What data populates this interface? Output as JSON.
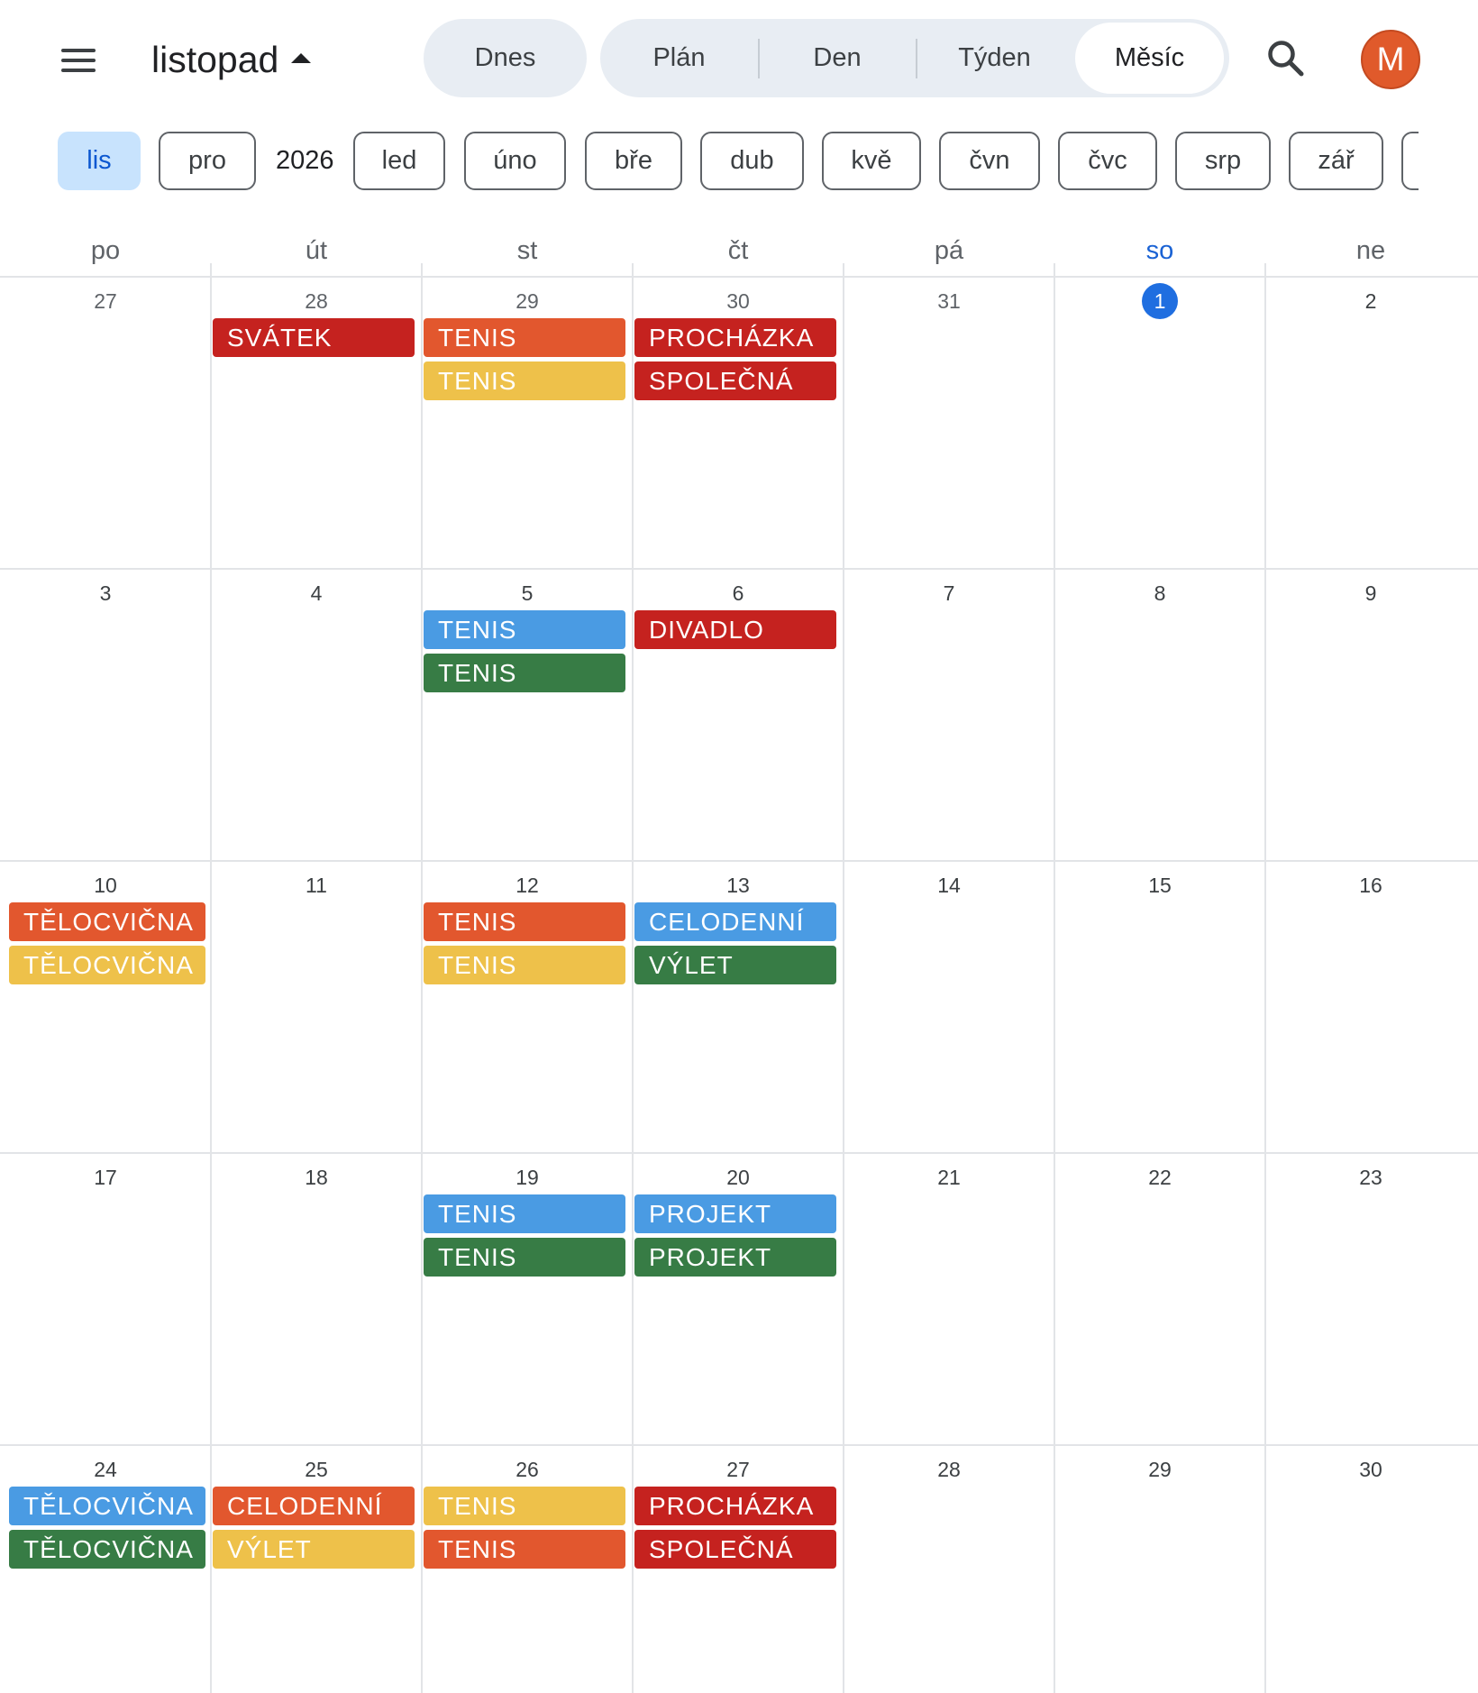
{
  "header": {
    "month": "listopad",
    "today_label": "Dnes",
    "views": [
      "Plán",
      "Den",
      "Týden",
      "Měsíc"
    ],
    "active_view": "Měsíc",
    "avatar_letter": "M",
    "icons": [
      "menu-icon",
      "caret-up-icon",
      "search-icon"
    ]
  },
  "month_chips": {
    "active": "lis",
    "prev_year": [
      "lis",
      "pro"
    ],
    "year": "2026",
    "next_year": [
      "led",
      "úno",
      "bře",
      "dub",
      "kvě",
      "čvn",
      "čvc",
      "srp",
      "zář"
    ]
  },
  "weekdays": [
    "po",
    "út",
    "st",
    "čt",
    "pá",
    "so",
    "ne"
  ],
  "weeks": [
    [
      {
        "day": "27",
        "other": true,
        "events": []
      },
      {
        "day": "28",
        "other": true,
        "events": [
          {
            "title": "SVÁTEK",
            "color": "red"
          }
        ]
      },
      {
        "day": "29",
        "other": true,
        "events": [
          {
            "title": "TENIS",
            "color": "orange"
          },
          {
            "title": "TENIS",
            "color": "yellow"
          }
        ]
      },
      {
        "day": "30",
        "other": true,
        "events": [
          {
            "title": "PROCHÁZKA",
            "color": "red"
          },
          {
            "title": "SPOLEČNÁ",
            "color": "red"
          }
        ]
      },
      {
        "day": "31",
        "other": true,
        "events": []
      },
      {
        "day": "1",
        "today": true,
        "events": []
      },
      {
        "day": "2",
        "events": []
      }
    ],
    [
      {
        "day": "3",
        "events": []
      },
      {
        "day": "4",
        "events": []
      },
      {
        "day": "5",
        "events": [
          {
            "title": "TENIS",
            "color": "blue"
          },
          {
            "title": "TENIS",
            "color": "green"
          }
        ]
      },
      {
        "day": "6",
        "events": [
          {
            "title": "DIVADLO",
            "color": "red"
          }
        ]
      },
      {
        "day": "7",
        "events": []
      },
      {
        "day": "8",
        "events": []
      },
      {
        "day": "9",
        "events": []
      }
    ],
    [
      {
        "day": "10",
        "events": [
          {
            "title": "TĚLOCVIČNA",
            "color": "orange"
          },
          {
            "title": "TĚLOCVIČNA",
            "color": "yellow"
          }
        ]
      },
      {
        "day": "11",
        "events": []
      },
      {
        "day": "12",
        "events": [
          {
            "title": "TENIS",
            "color": "orange"
          },
          {
            "title": "TENIS",
            "color": "yellow"
          }
        ]
      },
      {
        "day": "13",
        "events": [
          {
            "title": "CELODENNÍ",
            "color": "blue"
          },
          {
            "title": "VÝLET",
            "color": "green"
          }
        ]
      },
      {
        "day": "14",
        "events": []
      },
      {
        "day": "15",
        "events": []
      },
      {
        "day": "16",
        "events": []
      }
    ],
    [
      {
        "day": "17",
        "events": []
      },
      {
        "day": "18",
        "events": []
      },
      {
        "day": "19",
        "events": [
          {
            "title": "TENIS",
            "color": "blue"
          },
          {
            "title": "TENIS",
            "color": "green"
          }
        ]
      },
      {
        "day": "20",
        "events": [
          {
            "title": "PROJEKT",
            "color": "blue"
          },
          {
            "title": "PROJEKT",
            "color": "green"
          }
        ]
      },
      {
        "day": "21",
        "events": []
      },
      {
        "day": "22",
        "events": []
      },
      {
        "day": "23",
        "events": []
      }
    ],
    [
      {
        "day": "24",
        "events": [
          {
            "title": "TĚLOCVIČNA",
            "color": "blue"
          },
          {
            "title": "TĚLOCVIČNA",
            "color": "green"
          }
        ]
      },
      {
        "day": "25",
        "events": [
          {
            "title": "CELODENNÍ",
            "color": "orange"
          },
          {
            "title": "VÝLET",
            "color": "yellow"
          }
        ]
      },
      {
        "day": "26",
        "events": [
          {
            "title": "TENIS",
            "color": "yellow"
          },
          {
            "title": "TENIS",
            "color": "orange"
          }
        ]
      },
      {
        "day": "27",
        "events": [
          {
            "title": "PROCHÁZKA",
            "color": "red"
          },
          {
            "title": "SPOLEČNÁ",
            "color": "red"
          }
        ]
      },
      {
        "day": "28",
        "events": []
      },
      {
        "day": "29",
        "events": []
      },
      {
        "day": "30",
        "events": []
      }
    ]
  ],
  "colors": {
    "red": "#c5221f",
    "orange": "#e2572e",
    "yellow": "#eec14a",
    "blue": "#4a9be3",
    "green": "#377c45",
    "today": "#1f6ee0",
    "saturday_header": "#1a62d4",
    "avatar": "#e05a2b",
    "active_chip": "#c8e3fd"
  }
}
